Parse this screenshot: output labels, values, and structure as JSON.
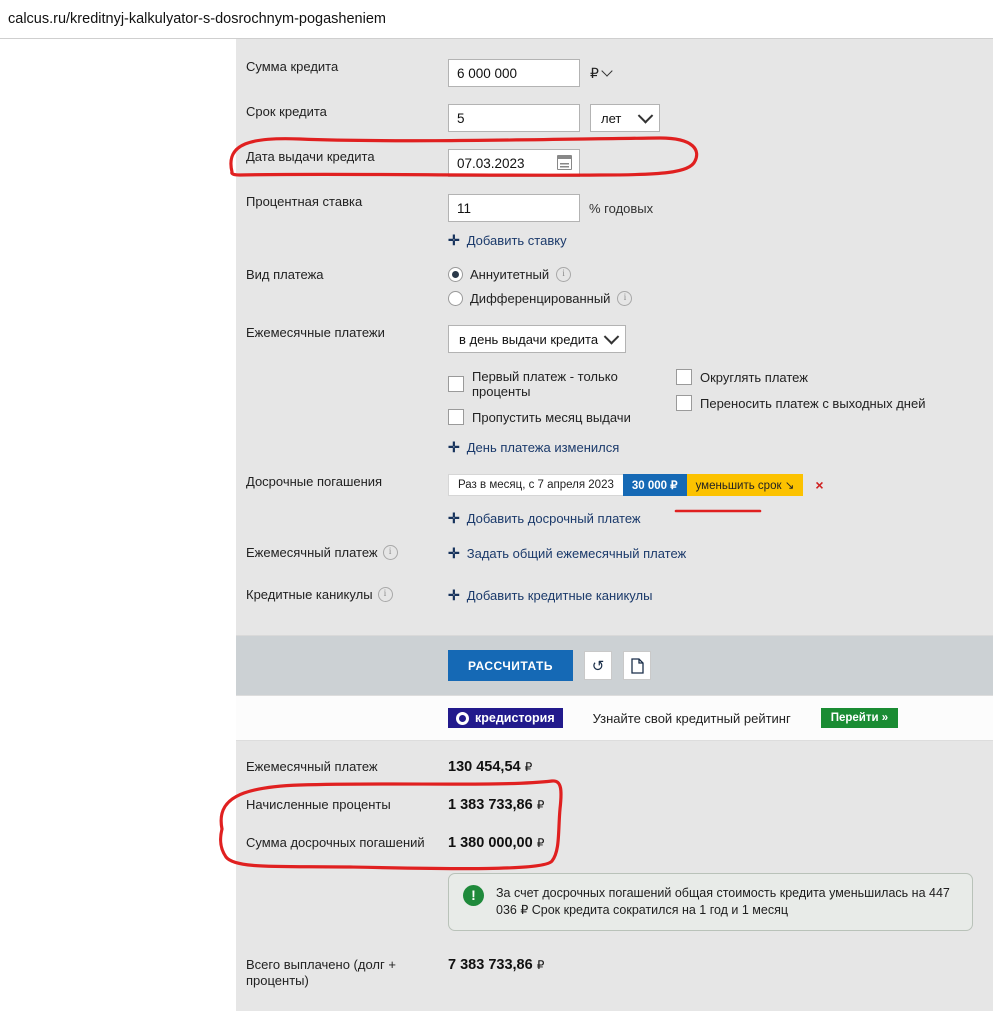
{
  "browser": {
    "url": "calcus.ru/kreditnyj-kalkulyator-s-dosrochnym-pogasheniem"
  },
  "form": {
    "amount": {
      "label": "Сумма кредита",
      "value": "6 000 000",
      "currency": "₽"
    },
    "term": {
      "label": "Срок кредита",
      "value": "5",
      "unit": "лет"
    },
    "issue_date": {
      "label": "Дата выдачи кредита",
      "value": "07.03.2023",
      "icon": "calendar-icon"
    },
    "rate": {
      "label": "Процентная ставка",
      "value": "11",
      "unit": "% годовых",
      "add_link": "Добавить ставку"
    },
    "payment_type": {
      "label": "Вид платежа",
      "options": [
        {
          "label": "Аннуитетный",
          "selected": true
        },
        {
          "label": "Дифференцированный",
          "selected": false
        }
      ]
    },
    "monthly_payments": {
      "label": "Ежемесячные платежи",
      "value": "в день выдачи кредита",
      "checkboxes": [
        {
          "label": "Первый платеж - только проценты",
          "checked": false
        },
        {
          "label": "Пропустить месяц выдачи",
          "checked": false
        },
        {
          "label": "Округлять платеж",
          "checked": false
        },
        {
          "label": "Переносить платеж с выходных дней",
          "checked": false
        }
      ],
      "add_link": "День платежа изменился"
    },
    "early_repayments": {
      "label": "Досрочные погашения",
      "entry_schedule": "Раз в месяц, с 7 апреля 2023",
      "entry_amount": "30 000 ₽",
      "entry_mode": "уменьшить срок ↘",
      "delete_icon": "×",
      "add_link": "Добавить досрочный платеж"
    },
    "monthly_payment_setting": {
      "label": "Ежемесячный платеж",
      "add_link": "Задать общий ежемесячный платеж"
    },
    "credit_holidays": {
      "label": "Кредитные каникулы",
      "add_link": "Добавить кредитные каникулы"
    }
  },
  "actions": {
    "calculate": "РАССЧИТАТЬ",
    "reset_icon": "undo-icon",
    "document_icon": "document-icon"
  },
  "banner": {
    "logo_text": "кредистория",
    "text": "Узнайте свой кредитный рейтинг",
    "button": "Перейти »"
  },
  "results": {
    "rows": [
      {
        "label": "Ежемесячный платеж",
        "value": "130 454,54",
        "currency": "₽"
      },
      {
        "label": "Начисленные проценты",
        "value": "1 383 733,86",
        "currency": "₽"
      },
      {
        "label": "Сумма досрочных погашений",
        "value": "1 380 000,00",
        "currency": "₽"
      }
    ],
    "notice": "За счет досрочных погашений общая стоимость кредита уменьшилась на 447 036 ₽ Срок кредита сократился на 1 год и 1 месяц",
    "total": {
      "label": "Всего выплачено (долг + проценты)",
      "value": "7 383 733,86",
      "currency": "₽"
    }
  },
  "colors": {
    "accent_blue": "#1569b5",
    "badge_yellow": "#fcc200",
    "green": "#1a8c33",
    "annotation_red": "#e02020",
    "logo_navy": "#221a8c"
  }
}
